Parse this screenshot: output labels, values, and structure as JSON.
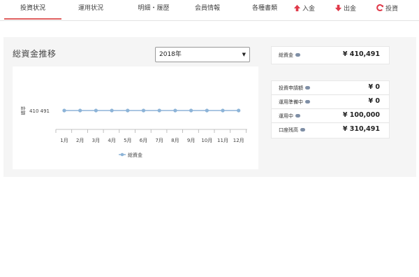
{
  "nav": {
    "tabs": [
      {
        "label": "投資状況",
        "active": true
      },
      {
        "label": "運用状況",
        "active": false
      },
      {
        "label": "明細・履歴",
        "active": false
      },
      {
        "label": "会員情報",
        "active": false
      },
      {
        "label": "各種書類",
        "active": false
      }
    ],
    "actions": [
      {
        "label": "入金",
        "icon": "arrow-up-icon",
        "color": "#e03a4a"
      },
      {
        "label": "出金",
        "icon": "arrow-down-icon",
        "color": "#e03a4a"
      },
      {
        "label": "投資",
        "icon": "refresh-icon",
        "color": "#e03a4a"
      }
    ]
  },
  "panel": {
    "title": "総資金推移",
    "year_select": "2018年"
  },
  "chart_data": {
    "type": "line",
    "categories": [
      "1月",
      "2月",
      "3月",
      "4月",
      "5月",
      "6月",
      "7月",
      "8月",
      "9月",
      "10月",
      "11月",
      "12月"
    ],
    "series": [
      {
        "name": "総資金",
        "values": [
          410491,
          410491,
          410491,
          410491,
          410491,
          410491,
          410491,
          410491,
          410491,
          410491,
          410491,
          410491
        ],
        "color": "#8db4d8"
      }
    ],
    "ylabel": "金額",
    "y_tick_labels": [
      "410 491"
    ],
    "legend_position": "bottom",
    "grid": false
  },
  "summary": {
    "total": {
      "label": "総資金",
      "value": "¥ 410,491"
    },
    "rows": [
      {
        "label": "投資申請額",
        "value": "¥ 0"
      },
      {
        "label": "運用準備中",
        "value": "¥ 0"
      },
      {
        "label": "運用中",
        "value": "¥ 100,000"
      },
      {
        "label": "口座残高",
        "value": "¥ 310,491"
      }
    ]
  }
}
